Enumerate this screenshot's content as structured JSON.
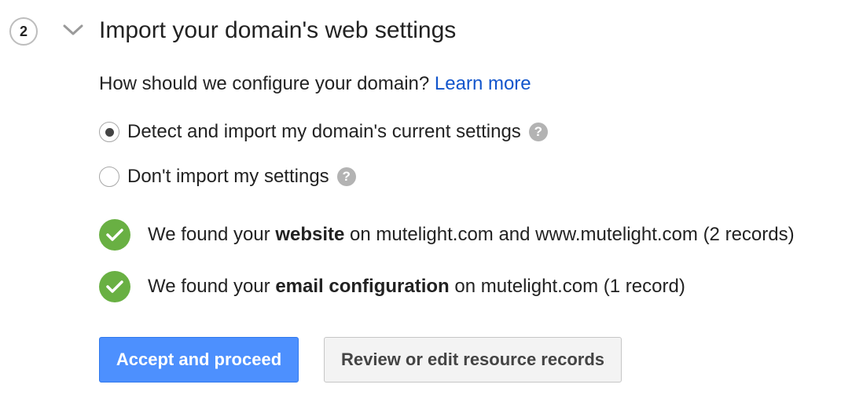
{
  "step": {
    "number": "2",
    "title": "Import your domain's web settings"
  },
  "question": {
    "text": "How should we configure your domain?",
    "link": "Learn more"
  },
  "options": [
    {
      "label": "Detect and import my domain's current settings",
      "checked": true,
      "help_icon": "question-mark"
    },
    {
      "label": "Don't import my settings",
      "checked": false,
      "help_icon": "question-mark"
    }
  ],
  "findings": [
    {
      "icon": "checkmark",
      "prefix": "We found your",
      "bold": "website",
      "suffix": "on mutelight.com and www.mutelight.com (2 records)"
    },
    {
      "icon": "checkmark",
      "prefix": "We found your",
      "bold": "email configuration",
      "suffix": "on mutelight.com (1 record)"
    }
  ],
  "buttons": {
    "accept": "Accept and proceed",
    "review": "Review or edit resource records"
  },
  "colors": {
    "primary": "#4d90fe",
    "link": "#1155cc",
    "success": "#69b043",
    "help": "#b3b3b3"
  }
}
